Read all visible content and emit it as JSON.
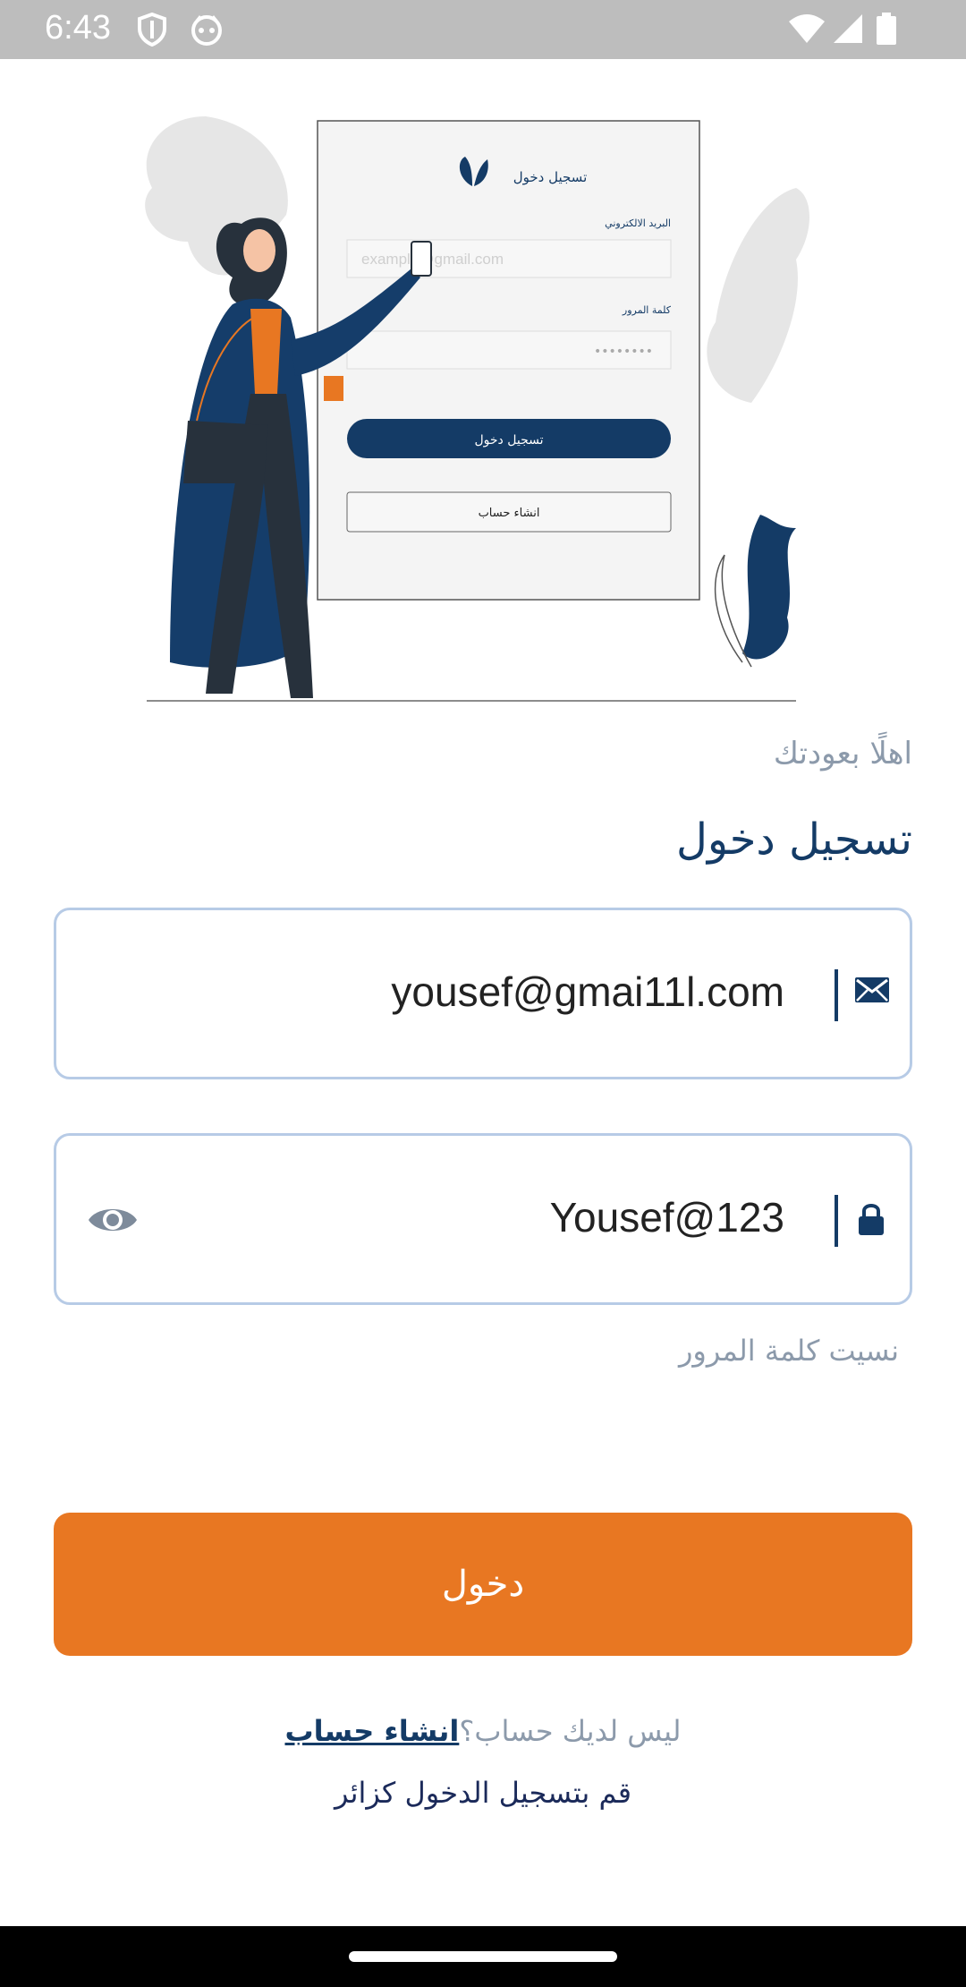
{
  "status_bar": {
    "time": "6:43",
    "icons": [
      "shield-icon",
      "cat-face-icon",
      "wifi-icon",
      "signal-icon",
      "battery-icon"
    ]
  },
  "illustration": {
    "card_title": "تسجيل دخول",
    "email_label": "البريد الالكتروني",
    "email_placeholder": "example@gmail.com",
    "password_label": "كلمة المرور",
    "password_mask": "••••••••",
    "login_button": "تسجيل دخول",
    "create_account_button": "انشاء حساب"
  },
  "welcome_text": "اهلًا بعودتك",
  "page_title": "تسجيل دخول",
  "email_field": {
    "value": "yousef@gmai11l.com",
    "icon": "envelope-icon"
  },
  "password_field": {
    "value": "Yousef@123",
    "icon": "lock-icon",
    "toggle_icon": "eye-icon"
  },
  "forgot_password": "نسيت كلمة المرور",
  "login_button": "دخول",
  "signup": {
    "question": "ليس لديك حساب؟",
    "link": "انشاء حساب"
  },
  "guest_login": "قم بتسجيل الدخول كزائر",
  "colors": {
    "primary": "#143b66",
    "accent": "#e87722",
    "muted_text": "#8c9aab",
    "field_border": "#b7cbe6"
  }
}
